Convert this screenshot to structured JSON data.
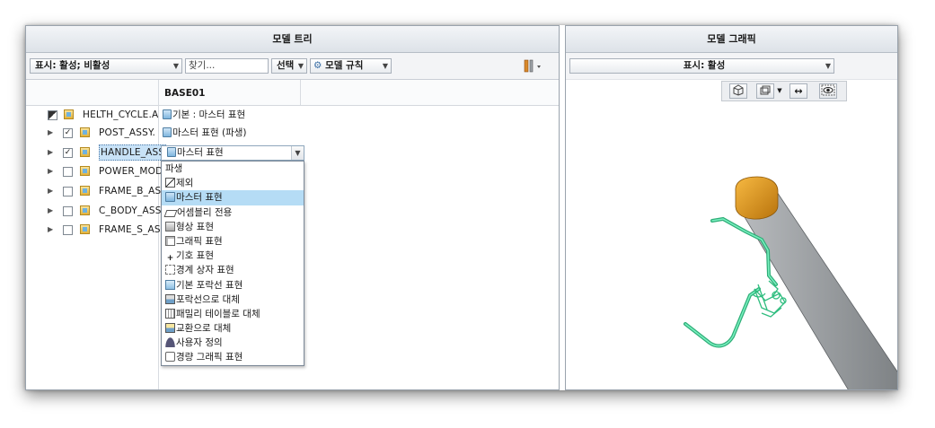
{
  "left_pane": {
    "title": "모델 트리",
    "toolbar": {
      "display_combo": "표시: 활성; 비활성",
      "search_placeholder": "찾기...",
      "select_combo": "선택",
      "model_rules_combo": "모델 규칙"
    },
    "column_header": "BASE01",
    "tree": [
      {
        "name": "HELTH_CYCLE.A",
        "checked": null,
        "expander": "none",
        "rep": "기본 : 마스터 표현",
        "selected": false
      },
      {
        "name": "POST_ASSY.",
        "checked": true,
        "expander": "collapsed",
        "rep": "마스터 표현 (파생)",
        "selected": false
      },
      {
        "name": "HANDLE_ASS",
        "checked": true,
        "expander": "collapsed",
        "rep": "",
        "selected": true
      },
      {
        "name": "POWER_MOD",
        "checked": false,
        "expander": "collapsed",
        "rep": "",
        "selected": false
      },
      {
        "name": "FRAME_B_AS",
        "checked": false,
        "expander": "collapsed",
        "rep": "",
        "selected": false
      },
      {
        "name": "C_BODY_ASS",
        "checked": false,
        "expander": "collapsed",
        "rep": "",
        "selected": false
      },
      {
        "name": "FRAME_S_AS",
        "checked": false,
        "expander": "collapsed",
        "rep": "",
        "selected": false
      }
    ],
    "rep_dropdown": {
      "current_value": "마스터 표현",
      "options": [
        {
          "label": "파생",
          "icon": "none-icon",
          "highlighted": false
        },
        {
          "label": "제외",
          "icon": "exclude-icon",
          "highlighted": false
        },
        {
          "label": "마스터 표현",
          "icon": "master-rep-icon",
          "highlighted": true
        },
        {
          "label": "어셈블리 전용",
          "icon": "assembly-only-icon",
          "highlighted": false
        },
        {
          "label": "형상 표현",
          "icon": "geometry-rep-icon",
          "highlighted": false
        },
        {
          "label": "그래픽 표현",
          "icon": "graphics-rep-icon",
          "highlighted": false
        },
        {
          "label": "기호 표현",
          "icon": "symbolic-rep-icon",
          "highlighted": false
        },
        {
          "label": "경계 상자 표현",
          "icon": "bounding-box-icon",
          "highlighted": false
        },
        {
          "label": "기본 포락선 표현",
          "icon": "default-envelope-icon",
          "highlighted": false
        },
        {
          "label": "포락선으로 대체",
          "icon": "envelope-substitute-icon",
          "highlighted": false
        },
        {
          "label": "패밀리 테이블로 대체",
          "icon": "family-table-icon",
          "highlighted": false
        },
        {
          "label": "교환으로 대체",
          "icon": "interchange-icon",
          "highlighted": false
        },
        {
          "label": "사용자 정의",
          "icon": "user-defined-icon",
          "highlighted": false
        },
        {
          "label": "경량 그래픽 표현",
          "icon": "lightweight-graphics-icon",
          "highlighted": false
        }
      ]
    }
  },
  "right_pane": {
    "title": "모델 그래픽",
    "display_combo": "표시: 활성",
    "view_toolbar": [
      "view-orientation-icon",
      "display-style-icon",
      "dropdown-icon",
      "spin-center-icon",
      "visibility-eye-icon"
    ]
  },
  "colors": {
    "cap_orange": "#e39a19",
    "frame_gray": "#8f9396",
    "handle_green": "#3ed39a",
    "highlight_blue": "#b5dcf5"
  }
}
